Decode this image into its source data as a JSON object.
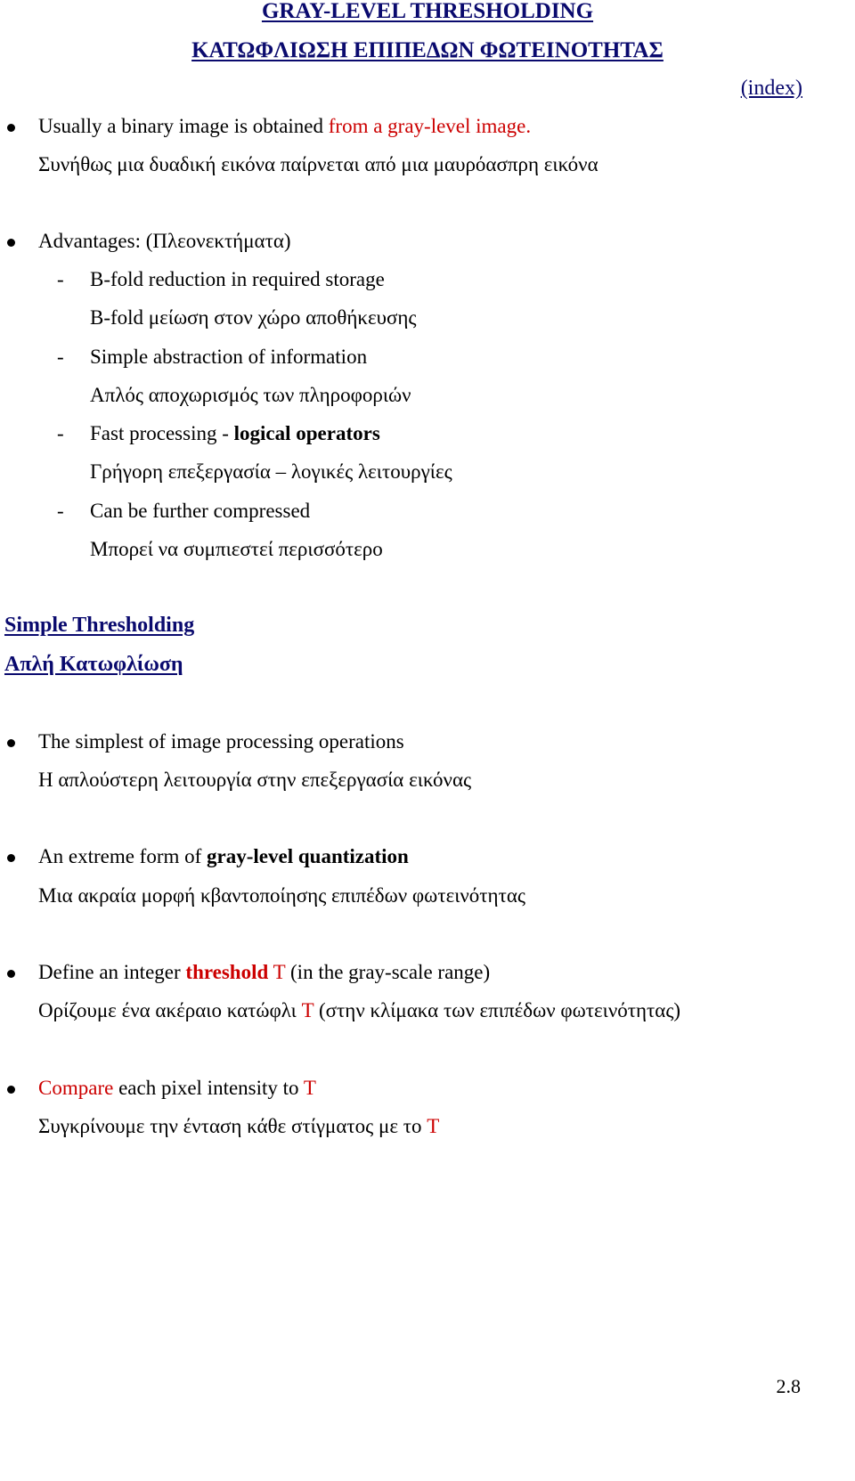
{
  "title": "GRAY-LEVEL THRESHOLDING",
  "title_greek": "ΚΑΤΩΦΛΙΩΣΗ ΕΠΙΠΕΔΩΝ ΦΩΤΕΙΝΟΤΗΤΑΣ",
  "index_link": "(index)",
  "intro": {
    "en_plain": "Usually a binary image is obtained ",
    "en_red": "from a gray-level image.",
    "gr": "Συνήθως μια δυαδική εικόνα παίρνεται από μια μαυρόασπρη εικόνα"
  },
  "advantages": {
    "heading": "Advantages:  (Πλεονεκτήματα)",
    "items": [
      {
        "en": "B-fold reduction in required storage",
        "gr": "B-fold μείωση στον χώρο αποθήκευσης"
      },
      {
        "en": "Simple abstraction of information",
        "gr": "Απλός αποχωρισμός των πληροφοριών"
      },
      {
        "en_plain": "Fast processing - ",
        "en_bold": "logical operators",
        "gr": "Γρήγορη επεξεργασία – λογικές λειτουργίες"
      },
      {
        "en": "Can be further compressed",
        "gr": "Μπορεί να συμπιεστεί περισσότερο"
      }
    ],
    "dash": "-"
  },
  "section": {
    "title": "Simple Thresholding",
    "title_greek": "Απλή Κατωφλίωση"
  },
  "points": [
    {
      "en": "The simplest of image processing operations",
      "gr": "Η απλούστερη λειτουργία στην επεξεργασία εικόνας"
    },
    {
      "en_plain": "An extreme form of ",
      "en_bold": "gray-level quantization",
      "gr": "Μια ακραία μορφή κβαντοποίησης επιπέδων φωτεινότητας"
    },
    {
      "en_a": "Define an integer ",
      "en_red_bold": "threshold",
      "en_red": " T",
      "en_b": " (in the gray-scale range)",
      "gr_a": "Ορίζουμε ένα ακέραιο κατώφλι ",
      "gr_red": "T",
      "gr_b": " (στην κλίμακα των επιπέδων φωτεινότητας)"
    },
    {
      "en_red": "Compare",
      "en_a": " each pixel intensity to ",
      "en_red2": "T",
      "gr_a": "Συγκρίνουμε την ένταση κάθε στίγματος με το ",
      "gr_red": "T"
    }
  ],
  "page_number": "2.8",
  "colors": {
    "heading": "#0a0a6e",
    "accent_red": "#cc0000",
    "text": "#000000"
  }
}
